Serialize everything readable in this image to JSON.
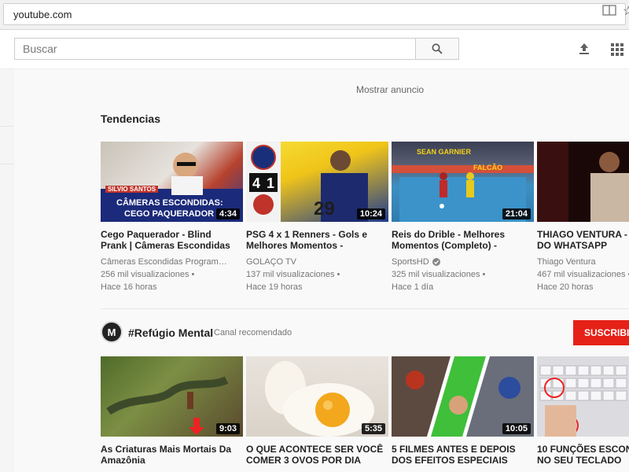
{
  "browser": {
    "url": "youtube.com"
  },
  "header": {
    "search_placeholder": "Buscar",
    "icons": [
      "search-icon",
      "upload-icon",
      "apps-icon"
    ]
  },
  "main": {
    "ad_link": "Mostrar anuncio",
    "trending": {
      "title": "Tendencias",
      "videos": [
        {
          "title_line1": "Cego Paquerador - Blind",
          "title_line2": "Prank | Câmeras Escondidas",
          "channel": "Câmeras Escondidas Program…",
          "views": "256 mil visualizaciones •",
          "time": "Hace 16 horas",
          "duration": "4:34",
          "thumb_caption1": "CÂMERAS ESCONDIDAS:",
          "thumb_caption2": "CEGO PAQUERADOR",
          "thumb_tag": "SILVIO SANTOS"
        },
        {
          "title_line1": "PSG 4 x 1 Renners - Gols e",
          "title_line2": "Melhores Momentos -",
          "channel": "GOLAÇO TV",
          "views": "137 mil visualizaciones •",
          "time": "Hace 19 horas",
          "duration": "10:24",
          "thumb_score1": "4",
          "thumb_score2": "1",
          "thumb_number": "29"
        },
        {
          "title_line1": "Reis do Drible - Melhores",
          "title_line2": "Momentos (Completo) -",
          "channel": "SportsHD",
          "views": "325 mil visualizaciones •",
          "time": "Hace 1 día",
          "duration": "21:04",
          "thumb_label1": "SEAN GARNIER",
          "thumb_label2": "FALCÃO"
        },
        {
          "title_line1": "THIAGO VENTURA - Á",
          "title_line2": "DO WHATSAPP",
          "channel": "Thiago Ventura",
          "views": "467 mil visualizaciones •",
          "time": "Hace 20 horas",
          "duration": ""
        }
      ]
    },
    "recommended": {
      "channel_name": "#Refúgio Mental",
      "channel_tag": "Canal recomendado",
      "avatar_letter": "M",
      "subscribe_label": "SUSCRIBIR",
      "videos": [
        {
          "title_line1": "As Criaturas Mais Mortais Da",
          "title_line2": "Amazônia",
          "duration": "9:03"
        },
        {
          "title_line1": "O QUE ACONTECE SER VOCÊ",
          "title_line2": "COMER 3 OVOS POR DIA",
          "duration": "5:35"
        },
        {
          "title_line1": "5 FILMES ANTES E DEPOIS",
          "title_line2": "DOS EFEITOS ESPECIAIS",
          "duration": "10:05"
        },
        {
          "title_line1": "10 FUNÇÕES ESCOND",
          "title_line2": "NO SEU TECLADO",
          "duration": ""
        }
      ]
    }
  },
  "colors": {
    "accent_red": "#e62117",
    "text_meta": "#767676",
    "background": "#f9f9f9"
  }
}
